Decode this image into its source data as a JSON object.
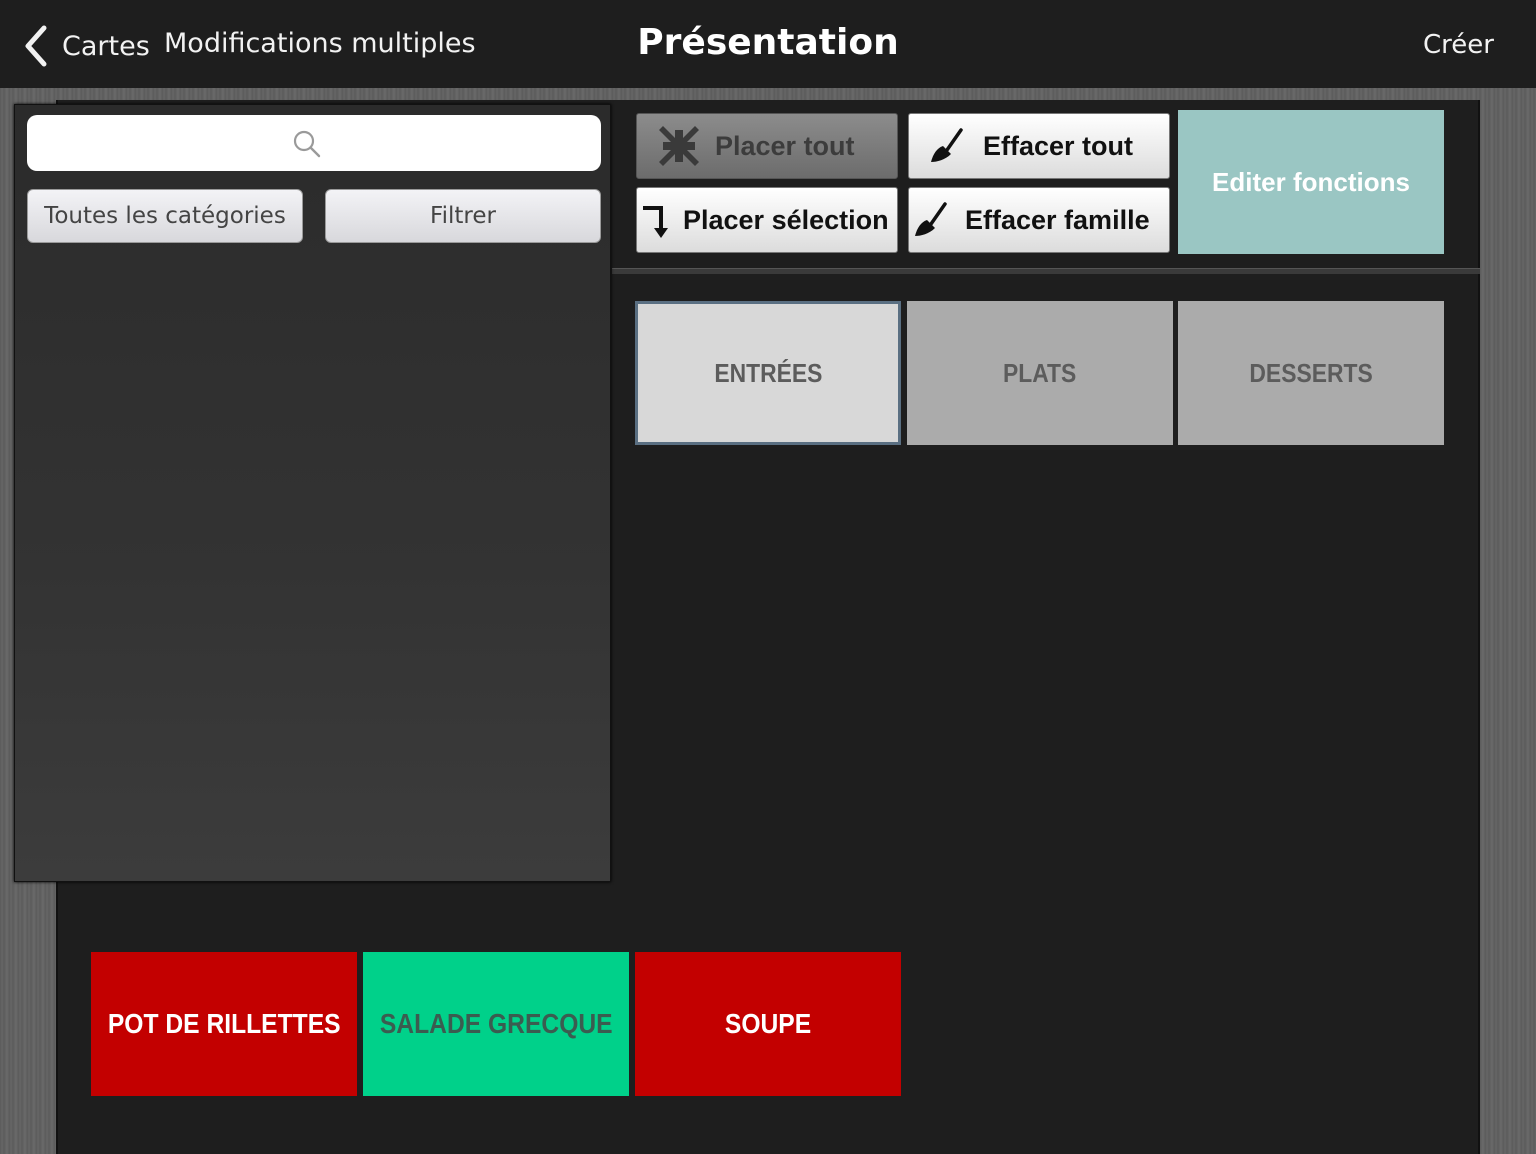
{
  "header": {
    "back_label": "Cartes",
    "multi_edit_label": "Modifications multiples",
    "title": "Présentation",
    "create_label": "Créer"
  },
  "left_panel": {
    "search": {
      "placeholder": "",
      "value": ""
    },
    "category_filter_label": "Toutes les catégories",
    "filter_button_label": "Filtrer"
  },
  "actions": {
    "place_all": {
      "label": "Placer tout",
      "enabled": false,
      "icon": "compress-arrows-icon"
    },
    "erase_all": {
      "label": "Effacer tout",
      "enabled": true,
      "icon": "broom-icon"
    },
    "place_selection": {
      "label": "Placer sélection",
      "enabled": true,
      "icon": "turn-down-arrow-icon"
    },
    "erase_family": {
      "label": "Effacer famille",
      "enabled": true,
      "icon": "broom-icon"
    },
    "edit_functions": {
      "label": "Editer fonctions",
      "color": "#9ac6c3"
    }
  },
  "categories": [
    {
      "label": "ENTRÉES",
      "selected": true,
      "color": "#d8d8d8"
    },
    {
      "label": "PLATS",
      "selected": false,
      "color": "#ababab"
    },
    {
      "label": "DESSERTS",
      "selected": false,
      "color": "#ababab"
    }
  ],
  "products": [
    {
      "label": "POT DE RILLETTES",
      "color": "#c30000"
    },
    {
      "label": "SALADE GRECQUE",
      "color": "#00d18a"
    },
    {
      "label": "SOUPE",
      "color": "#c30000"
    }
  ]
}
